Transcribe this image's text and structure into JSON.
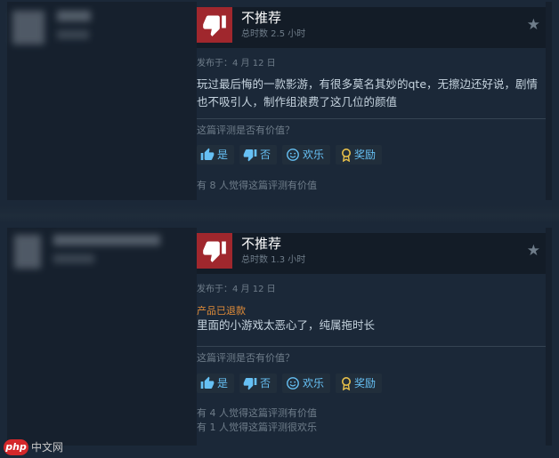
{
  "reviews": [
    {
      "verdict": "不推荐",
      "hours": "总时数 2.5 小时",
      "posted": "发布于：4 月 12 日",
      "refund_tag": "",
      "text": "玩过最后悔的一款影游，有很多莫名其妙的qte，无擦边还好说，剧情也不吸引人，制作组浪费了这几位的颜值",
      "question": "这篇评测是否有价值？",
      "buttons": {
        "yes": "是",
        "no": "否",
        "funny": "欢乐",
        "award": "奖励"
      },
      "helpful": "有 8 人觉得这篇评测有价值",
      "funny_count": ""
    },
    {
      "verdict": "不推荐",
      "hours": "总时数 1.3 小时",
      "posted": "发布于：4 月 12 日",
      "refund_tag": "产品已退款",
      "text": "里面的小游戏太恶心了，纯属拖时长",
      "question": "这篇评测是否有价值？",
      "buttons": {
        "yes": "是",
        "no": "否",
        "funny": "欢乐",
        "award": "奖励"
      },
      "helpful": "有 4 人觉得这篇评测有价值",
      "funny_count": "有 1 人觉得这篇评测很欢乐"
    }
  ],
  "icons": {
    "verdict": "thumbs-down-icon",
    "award": "star-icon",
    "yes": "thumbs-up-icon",
    "no": "thumbs-down-icon",
    "funny": "smiley-icon",
    "reward": "award-ribbon-icon"
  },
  "colors": {
    "page_bg": "#1b2838",
    "thumb_down_bg": "#a0272d",
    "link": "#66c0f4",
    "refund": "#e08c38"
  },
  "watermark": {
    "logo": "php",
    "text": "中文网"
  }
}
